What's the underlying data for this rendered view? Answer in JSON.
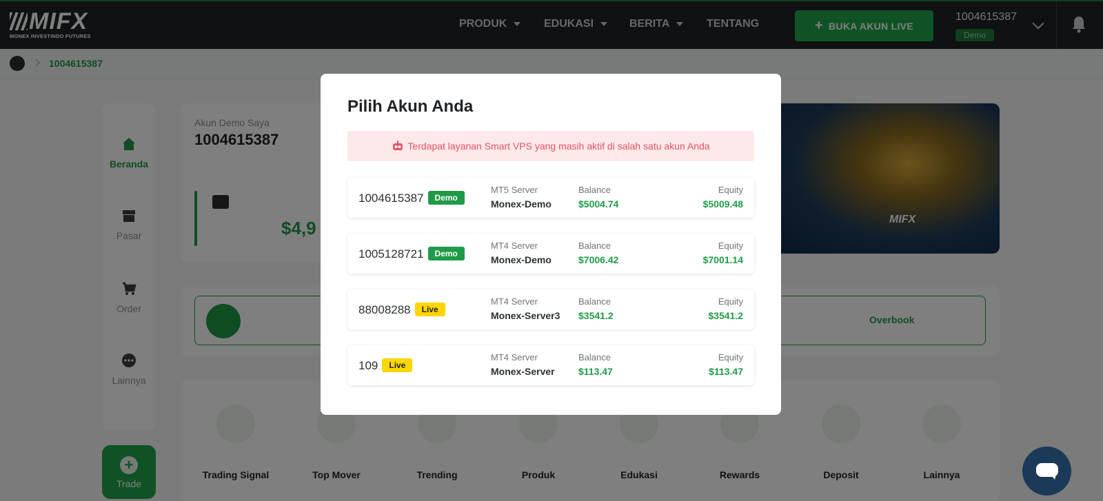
{
  "header": {
    "logo_text": "MIFX",
    "logo_subtitle": "MONEX INVESTINDO FUTURES",
    "nav": [
      {
        "label": "PRODUK",
        "has_caret": true
      },
      {
        "label": "EDUKASI",
        "has_caret": true
      },
      {
        "label": "BERITA",
        "has_caret": true
      },
      {
        "label": "TENTANG",
        "has_caret": false
      }
    ],
    "cta_label": "BUKA AKUN LIVE",
    "account_number": "1004615387",
    "account_type": "Demo"
  },
  "breadcrumb": {
    "current": "1004615387"
  },
  "sidebar": {
    "items": [
      {
        "label": "Beranda",
        "icon": "home-icon",
        "active": true
      },
      {
        "label": "Pasar",
        "icon": "store-icon",
        "active": false
      },
      {
        "label": "Order",
        "icon": "cart-icon",
        "active": false
      },
      {
        "label": "Lainnya",
        "icon": "more-icon",
        "active": false
      }
    ],
    "trade_label": "Trade"
  },
  "account_card": {
    "label": "Akun Demo Saya",
    "number": "1004615387",
    "balance_partial": "$4,9"
  },
  "strip": {
    "overbook_label": "Overbook"
  },
  "menu": {
    "items": [
      {
        "label": "Trading Signal",
        "icon": "signal-icon"
      },
      {
        "label": "Top Mover",
        "icon": "top-mover-icon"
      },
      {
        "label": "Trending",
        "icon": "shopping-bag-icon"
      },
      {
        "label": "Produk",
        "icon": "product-box-icon"
      },
      {
        "label": "Edukasi",
        "icon": "graduation-cap-icon"
      },
      {
        "label": "Rewards",
        "icon": "gift-icon"
      },
      {
        "label": "Deposit",
        "icon": "wallet-icon"
      },
      {
        "label": "Lainnya",
        "icon": "dots-icon"
      }
    ]
  },
  "modal": {
    "title": "Pilih Akun Anda",
    "alert": "Terdapat layanan Smart VPS yang masih aktif di salah satu akun Anda",
    "balance_label": "Balance",
    "equity_label": "Equity",
    "accounts": [
      {
        "number": "1004615387",
        "type": "Demo",
        "server_label": "MT5 Server",
        "server": "Monex-Demo",
        "balance": "$5004.74",
        "equity": "$5009.48"
      },
      {
        "number": "1005128721",
        "type": "Demo",
        "server_label": "MT4 Server",
        "server": "Monex-Demo",
        "balance": "$7006.42",
        "equity": "$7001.14"
      },
      {
        "number": "88008288",
        "type": "Live",
        "server_label": "MT4 Server",
        "server": "Monex-Server3",
        "balance": "$3541.2",
        "equity": "$3541.2"
      },
      {
        "number": "109",
        "type": "Live",
        "server_label": "MT4 Server",
        "server": "Monex-Server",
        "balance": "$113.47",
        "equity": "$113.47"
      }
    ]
  },
  "colors": {
    "brand_green": "#1f9a47",
    "live_yellow": "#ffd500",
    "header_bg": "#1f2224",
    "alert_bg": "#fde8ea",
    "alert_text": "#e05563"
  }
}
